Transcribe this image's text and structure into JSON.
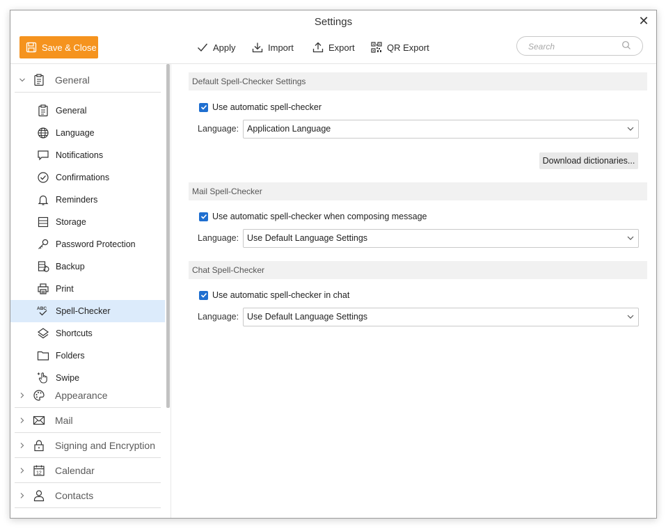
{
  "window": {
    "title": "Settings",
    "close_label": "✕"
  },
  "toolbar": {
    "save_label": "Save & Close",
    "apply_label": "Apply",
    "import_label": "Import",
    "export_label": "Export",
    "qr_export_label": "QR Export",
    "search_placeholder": "Search"
  },
  "sidebar": {
    "general_group": "General",
    "items": [
      {
        "label": "General",
        "icon": "clipboard-icon"
      },
      {
        "label": "Language",
        "icon": "globe-icon"
      },
      {
        "label": "Notifications",
        "icon": "chat-bubble-icon"
      },
      {
        "label": "Confirmations",
        "icon": "check-circle-icon"
      },
      {
        "label": "Reminders",
        "icon": "bell-icon"
      },
      {
        "label": "Storage",
        "icon": "storage-icon"
      },
      {
        "label": "Password Protection",
        "icon": "key-icon"
      },
      {
        "label": "Backup",
        "icon": "backup-icon"
      },
      {
        "label": "Print",
        "icon": "printer-icon"
      },
      {
        "label": "Spell-Checker",
        "icon": "abc-check-icon"
      },
      {
        "label": "Shortcuts",
        "icon": "shortcuts-icon"
      },
      {
        "label": "Folders",
        "icon": "folder-icon"
      },
      {
        "label": "Swipe",
        "icon": "swipe-hand-icon"
      }
    ],
    "selected_item": "Spell-Checker",
    "groups": [
      {
        "label": "Appearance",
        "icon": "palette-icon"
      },
      {
        "label": "Mail",
        "icon": "envelope-icon"
      },
      {
        "label": "Signing and Encryption",
        "icon": "lock-icon"
      },
      {
        "label": "Calendar",
        "icon": "calendar-icon"
      },
      {
        "label": "Contacts",
        "icon": "person-icon"
      }
    ]
  },
  "content": {
    "default_section": {
      "title": "Default Spell-Checker Settings",
      "checkbox_label": "Use automatic spell-checker",
      "checked": true,
      "language_label": "Language:",
      "language_value": "Application Language",
      "download_label": "Download dictionaries..."
    },
    "mail_section": {
      "title": "Mail Spell-Checker",
      "checkbox_label": "Use automatic spell-checker when composing message",
      "checked": true,
      "language_label": "Language:",
      "language_value": "Use Default Language Settings"
    },
    "chat_section": {
      "title": "Chat Spell-Checker",
      "checkbox_label": "Use automatic spell-checker in chat",
      "checked": true,
      "language_label": "Language:",
      "language_value": "Use Default Language Settings"
    }
  },
  "colors": {
    "accent": "#f5931e",
    "selected_bg": "#dcebfb",
    "checkbox": "#1f6fd0"
  }
}
